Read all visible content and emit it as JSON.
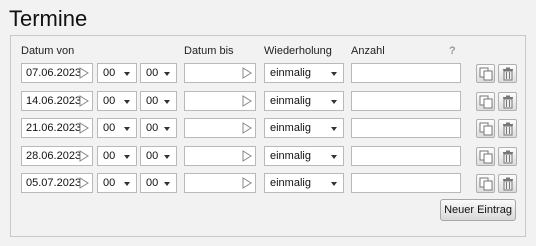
{
  "title": "Termine",
  "headers": {
    "datum_von": "Datum von",
    "datum_bis": "Datum bis",
    "wiederholung": "Wiederholung",
    "anzahl": "Anzahl",
    "help": "?"
  },
  "rows": [
    {
      "datum_von": "07.06.2023",
      "stunde": "00",
      "minute": "00",
      "datum_bis": "",
      "wiederholung": "einmalig",
      "anzahl": ""
    },
    {
      "datum_von": "14.06.2023",
      "stunde": "00",
      "minute": "00",
      "datum_bis": "",
      "wiederholung": "einmalig",
      "anzahl": ""
    },
    {
      "datum_von": "21.06.2023",
      "stunde": "00",
      "minute": "00",
      "datum_bis": "",
      "wiederholung": "einmalig",
      "anzahl": ""
    },
    {
      "datum_von": "28.06.2023",
      "stunde": "00",
      "minute": "00",
      "datum_bis": "",
      "wiederholung": "einmalig",
      "anzahl": ""
    },
    {
      "datum_von": "05.07.2023",
      "stunde": "00",
      "minute": "00",
      "datum_bis": "",
      "wiederholung": "einmalig",
      "anzahl": ""
    }
  ],
  "icons": {
    "calendar": "calendar-picker-icon",
    "copy": "copy-icon",
    "delete": "trash-icon"
  },
  "new_entry_label": "Neuer Eintrag"
}
